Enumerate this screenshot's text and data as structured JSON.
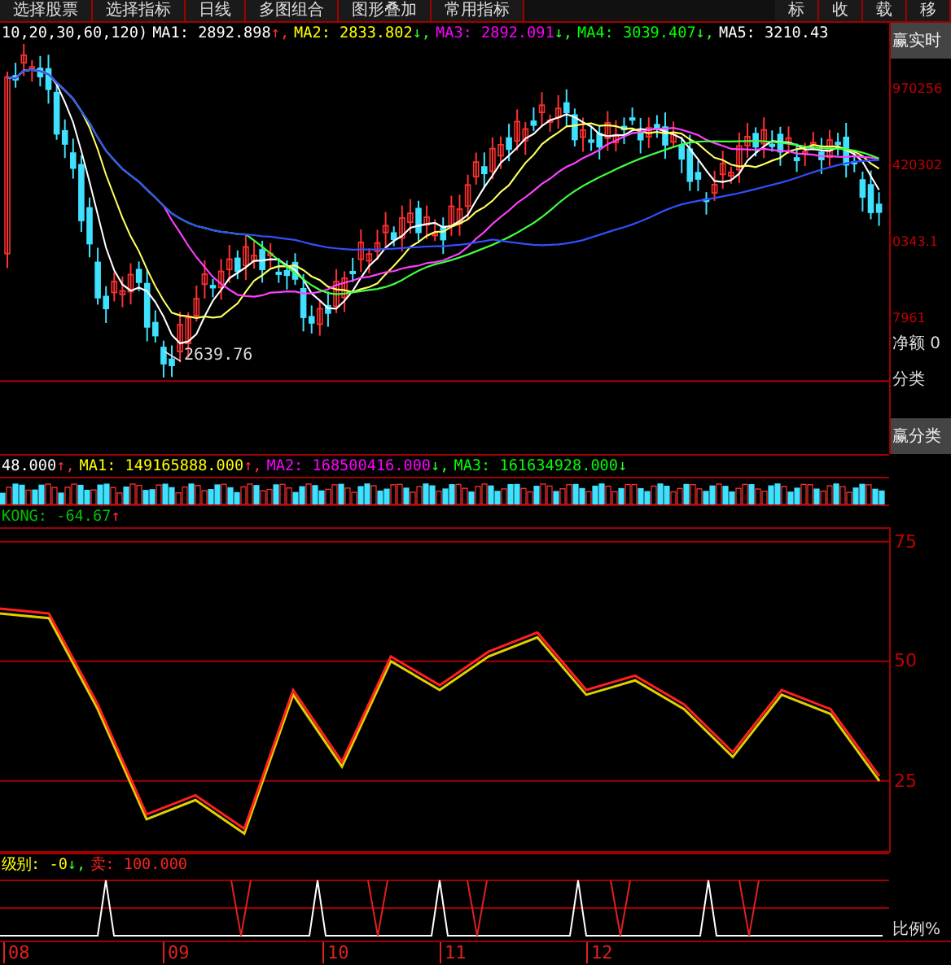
{
  "toolbar": {
    "items": [
      {
        "label": "选择股票"
      },
      {
        "label": "选择指标"
      },
      {
        "label": "日线"
      },
      {
        "label": "多图组合"
      },
      {
        "label": "图形叠加"
      },
      {
        "label": "常用指标"
      }
    ],
    "right_items": [
      "标",
      "收",
      "载",
      "移"
    ]
  },
  "price_panel": {
    "legend": [
      {
        "label": "10,20,30,60,120)",
        "color": "#ffffff"
      },
      {
        "label": "MA1:",
        "value": "2892.898",
        "arrow": "↑,",
        "rising": true,
        "color": "#ffffff"
      },
      {
        "label": "MA2:",
        "value": "2833.802",
        "arrow": "↓,",
        "rising": false,
        "color": "#ffff00"
      },
      {
        "label": "MA3:",
        "value": "2892.091",
        "arrow": "↓,",
        "rising": false,
        "color": "#ff00ff"
      },
      {
        "label": "MA4:",
        "value": "3039.407",
        "arrow": "↓,",
        "rising": false,
        "color": "#00ff00"
      },
      {
        "label": "MA5:",
        "value": "3210.43",
        "color": "#ffffff"
      }
    ],
    "low_marker": "2639.76"
  },
  "volume_panel": {
    "legend": [
      {
        "value": "48.000",
        "arrow": "↑,",
        "rising": true,
        "color": "#ffffff"
      },
      {
        "label": "MA1:",
        "value": "149165888.000",
        "arrow": "↑,",
        "rising": true,
        "color": "#ffff00"
      },
      {
        "label": "MA2:",
        "value": "168500416.000",
        "arrow": "↓,",
        "rising": false,
        "color": "#ff00ff"
      },
      {
        "label": "MA3:",
        "value": "161634928.000",
        "arrow": "↓",
        "rising": false,
        "color": "#00ff00"
      }
    ]
  },
  "indicator_panel": {
    "legend": [
      {
        "label": "KONG:",
        "value": "-64.67",
        "arrow": "↑",
        "rising": true,
        "color": "#00c000"
      }
    ],
    "chart_data": {
      "type": "line",
      "categories": [
        null,
        null,
        null,
        null,
        null,
        null,
        null,
        null,
        null,
        null,
        null,
        null,
        null,
        null,
        null,
        null,
        null,
        null,
        null
      ],
      "ylim": [
        10,
        78
      ],
      "yticks": [
        25,
        50,
        75
      ],
      "grid": true,
      "series": [
        {
          "color": "#e0d000",
          "values": [
            60,
            59,
            40,
            17,
            21,
            14,
            43,
            28,
            50,
            44,
            51,
            55,
            43,
            46,
            40,
            30,
            43,
            39,
            25
          ]
        },
        {
          "color": "#ff2020",
          "values": [
            61,
            60,
            41,
            18,
            22,
            15,
            44,
            29,
            51,
            45,
            52,
            56,
            44,
            47,
            41,
            31,
            44,
            40,
            26
          ]
        }
      ]
    }
  },
  "signal_panel": {
    "legend": [
      {
        "label": "级别:",
        "value": "-0",
        "arrow": "↓,",
        "rising": false,
        "color": "#ffff00"
      },
      {
        "label": "卖:",
        "value": "100.000",
        "color": "#ff2020"
      }
    ]
  },
  "x_axis": [
    "08",
    "09",
    "10",
    "11",
    "12"
  ],
  "side_panel": {
    "header": "赢实时",
    "price_labels": [
      "970256",
      "420302",
      "0343.1",
      "7961"
    ],
    "net_label": "净额 0",
    "category_label": "分类",
    "section_header": "赢分类",
    "ratio_label": "比例%"
  }
}
